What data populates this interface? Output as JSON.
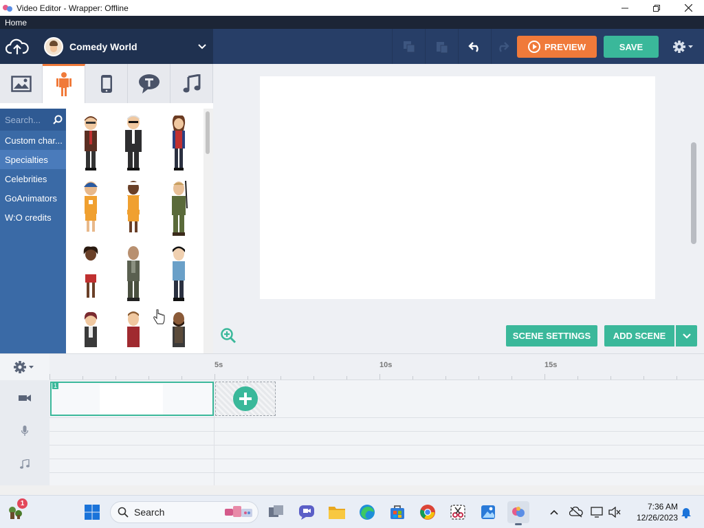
{
  "window": {
    "title": "Video Editor - Wrapper: Offline",
    "controls": {
      "minimize": "—",
      "maximize": "❐",
      "close": "✕"
    }
  },
  "menubar": {
    "items": [
      "Home"
    ]
  },
  "toolbar": {
    "theme_name": "Comedy World",
    "preview_label": "PREVIEW",
    "save_label": "SAVE",
    "colors": {
      "preview": "#f07a3a",
      "save": "#3ab89a",
      "bar": "#273e67"
    }
  },
  "asset_tabs": [
    {
      "name": "backgrounds",
      "icon": "image-icon"
    },
    {
      "name": "characters",
      "icon": "person-icon",
      "active": true
    },
    {
      "name": "props",
      "icon": "phone-icon"
    },
    {
      "name": "text",
      "icon": "speech-bubble-icon"
    },
    {
      "name": "sounds",
      "icon": "music-note-icon"
    }
  ],
  "library": {
    "search_placeholder": "Search...",
    "categories": [
      {
        "label": "Custom char...",
        "selected": false
      },
      {
        "label": "Specialties",
        "selected": true
      },
      {
        "label": "Celebrities",
        "selected": false
      },
      {
        "label": "GoAnimators",
        "selected": false
      },
      {
        "label": "W:O credits",
        "selected": false
      }
    ]
  },
  "stage": {
    "scene_settings_label": "SCENE SETTINGS",
    "add_scene_label": "ADD SCENE"
  },
  "timeline": {
    "ruler_labels": [
      "5s",
      "10s",
      "15s"
    ],
    "scene_number": "1"
  },
  "taskbar": {
    "search_label": "Search",
    "notification_count": "1",
    "time": "7:36 AM",
    "date": "12/26/2023"
  }
}
